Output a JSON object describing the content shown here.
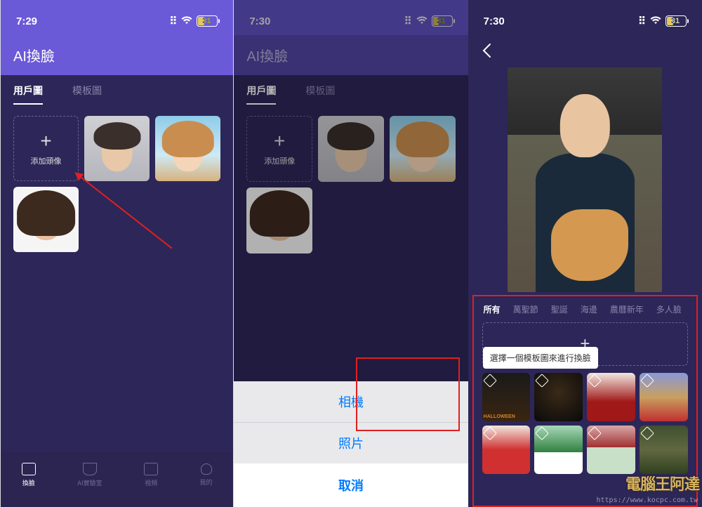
{
  "screen1": {
    "status": {
      "time": "7:29",
      "battery_pct": "31"
    },
    "header": "AI換臉",
    "tabs": {
      "user": "用戶圖",
      "template": "模板圖"
    },
    "add": {
      "plus": "+",
      "label": "添加頭像"
    },
    "bottom_nav": {
      "swap": "換臉",
      "lab": "AI實驗室",
      "video": "視頻",
      "mine": "我的"
    }
  },
  "screen2": {
    "status": {
      "time": "7:30",
      "battery_pct": "31"
    },
    "header": "AI換臉",
    "tabs": {
      "user": "用戶圖",
      "template": "模板圖"
    },
    "add": {
      "plus": "+",
      "label": "添加頭像"
    },
    "sheet": {
      "camera": "相機",
      "photo": "照片",
      "cancel": "取消"
    }
  },
  "screen3": {
    "status": {
      "time": "7:30",
      "battery_pct": "31"
    },
    "categories": {
      "all": "所有",
      "halloween": "萬聖節",
      "xmas": "聖誕",
      "coast": "海邊",
      "lunar": "農曆新年",
      "multi": "多人臉"
    },
    "add_plus": "+",
    "tooltip": "選擇一個模板圖來進行換臉"
  },
  "watermark": {
    "logo_text": "電腦王阿達",
    "url": "https://www.kocpc.com.tw"
  }
}
